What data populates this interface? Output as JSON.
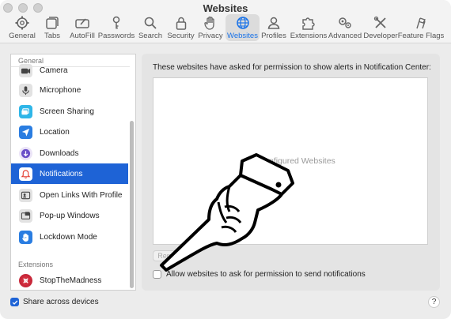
{
  "window": {
    "title": "Websites"
  },
  "toolbar": {
    "items": [
      {
        "label": "General",
        "icon": "gear-icon"
      },
      {
        "label": "Tabs",
        "icon": "tabs-icon"
      },
      {
        "label": "AutoFill",
        "icon": "autofill-icon"
      },
      {
        "label": "Passwords",
        "icon": "key-icon"
      },
      {
        "label": "Search",
        "icon": "search-icon"
      },
      {
        "label": "Security",
        "icon": "lock-icon"
      },
      {
        "label": "Privacy",
        "icon": "hand-icon"
      },
      {
        "label": "Websites",
        "icon": "globe-icon"
      },
      {
        "label": "Profiles",
        "icon": "person-icon"
      },
      {
        "label": "Extensions",
        "icon": "puzzle-icon"
      },
      {
        "label": "Advanced",
        "icon": "gears-icon"
      },
      {
        "label": "Developer",
        "icon": "tools-icon"
      },
      {
        "label": "Feature Flags",
        "icon": "flags-icon"
      }
    ],
    "active": "Websites"
  },
  "sidebar": {
    "section_general": "General",
    "items": [
      {
        "label": "Camera",
        "icon": "camera-icon"
      },
      {
        "label": "Microphone",
        "icon": "microphone-icon"
      },
      {
        "label": "Screen Sharing",
        "icon": "screen-sharing-icon"
      },
      {
        "label": "Location",
        "icon": "location-icon"
      },
      {
        "label": "Downloads",
        "icon": "downloads-icon"
      },
      {
        "label": "Notifications",
        "icon": "notifications-icon"
      },
      {
        "label": "Open Links With Profile",
        "icon": "profile-card-icon"
      },
      {
        "label": "Pop-up Windows",
        "icon": "popup-icon"
      },
      {
        "label": "Lockdown Mode",
        "icon": "lockdown-hand-icon"
      }
    ],
    "selected": "Notifications",
    "section_extensions": "Extensions",
    "extensions": [
      {
        "label": "StopTheMadness",
        "icon": "stopthemadness-icon"
      }
    ]
  },
  "panel": {
    "description": "These websites have asked for permission to show alerts in Notification Center:",
    "empty_text": "No Configured Websites",
    "remove_label": "Remove",
    "allow_label": "Allow websites to ask for permission to send notifications",
    "allow_checked": false
  },
  "footer": {
    "share_label": "Share across devices",
    "share_checked": true,
    "help_label": "?"
  },
  "colors": {
    "accent": "#1e63d6",
    "active_tab_text": "#1a73e8"
  }
}
